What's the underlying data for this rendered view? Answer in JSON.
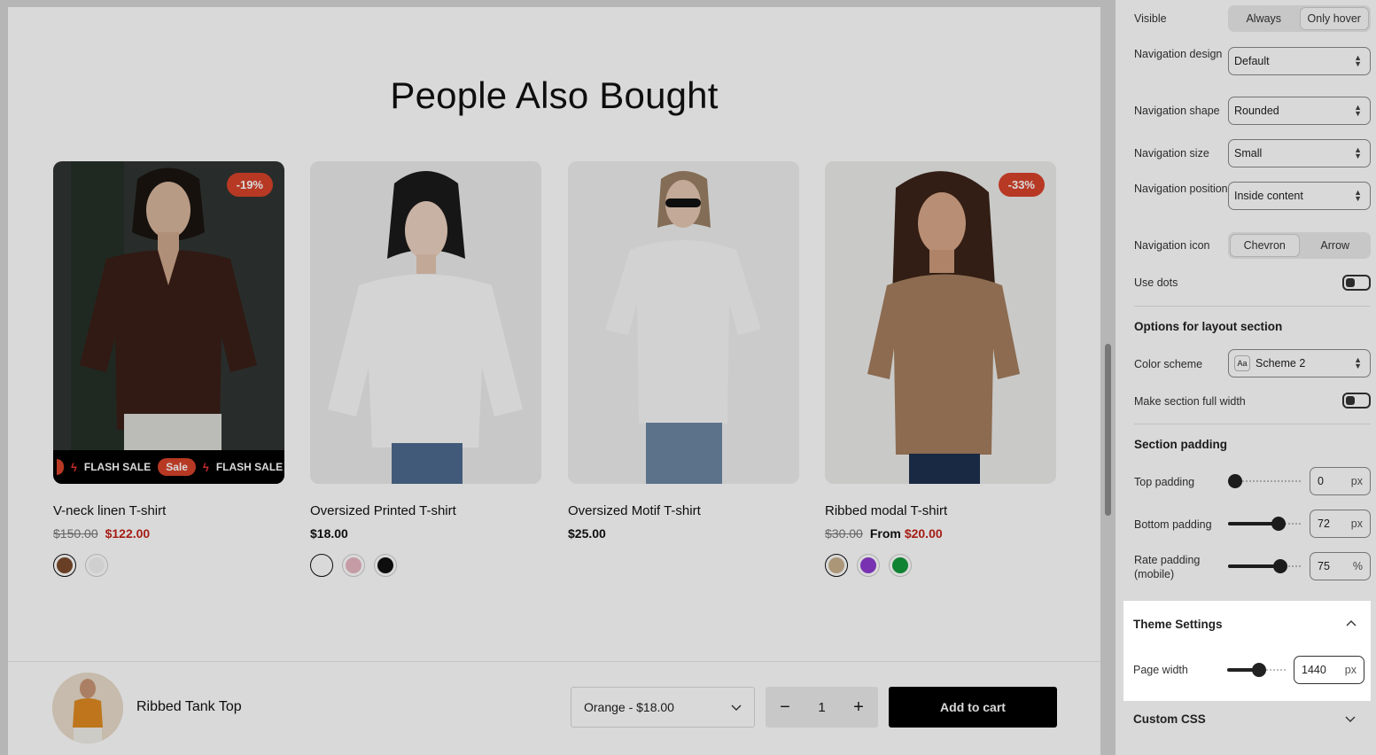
{
  "section": {
    "title": "People Also Bought"
  },
  "products": [
    {
      "name": "V-neck linen T-shirt",
      "price_old": "$150.00",
      "price": "$122.00",
      "price_prefix": "",
      "badge": "-19%",
      "flash": {
        "text1": "FLASH SALE",
        "pill": "Sale",
        "text2": "FLASH SALE"
      },
      "swatches": [
        "#7b4a2c",
        "#f4f4f4"
      ],
      "shirt_color": "#3a1f17",
      "bg": "#2f3533"
    },
    {
      "name": "Oversized Printed T-shirt",
      "price_old": "",
      "price": "$18.00",
      "price_prefix": "",
      "badge": "",
      "swatches": [
        "#ffffff",
        "#e8b8c3",
        "#111111"
      ],
      "shirt_color": "#fafafa",
      "bg": "#ebebeb"
    },
    {
      "name": "Oversized Motif T-shirt",
      "price_old": "",
      "price": "$25.00",
      "price_prefix": "",
      "badge": "",
      "swatches": [],
      "shirt_color": "#f7f7f7",
      "bg": "#efefef"
    },
    {
      "name": "Ribbed modal T-shirt",
      "price_old": "$30.00",
      "price": "$20.00",
      "price_prefix": "From",
      "badge": "-33%",
      "swatches": [
        "#c9b28e",
        "#8e3bd0",
        "#139a3b"
      ],
      "shirt_color": "#a57e5e",
      "bg": "#ededeb"
    }
  ],
  "sticky": {
    "name": "Ribbed Tank Top",
    "variant": "Orange - $18.00",
    "qty": "1",
    "minus": "−",
    "plus": "+",
    "add_to_cart": "Add to cart"
  },
  "panel": {
    "visible": {
      "label": "Visible",
      "options": [
        "Always",
        "Only hover"
      ]
    },
    "nav_design": {
      "label": "Navigation design",
      "value": "Default"
    },
    "nav_shape": {
      "label": "Navigation shape",
      "value": "Rounded"
    },
    "nav_size": {
      "label": "Navigation size",
      "value": "Small"
    },
    "nav_position": {
      "label": "Navigation position",
      "value": "Inside content"
    },
    "nav_icon": {
      "label": "Navigation icon",
      "options": [
        "Chevron",
        "Arrow"
      ]
    },
    "use_dots": {
      "label": "Use dots"
    },
    "layout_heading": "Options for layout section",
    "color_scheme": {
      "label": "Color scheme",
      "icon_text": "Aa",
      "value": "Scheme 2"
    },
    "full_width": {
      "label": "Make section full width"
    },
    "padding_heading": "Section padding",
    "top_padding": {
      "label": "Top padding",
      "value": "0",
      "unit": "px",
      "level": 0
    },
    "bottom_padding": {
      "label": "Bottom padding",
      "value": "72",
      "unit": "px",
      "level": 0.68
    },
    "rate_padding": {
      "label": "Rate padding (mobile)",
      "value": "75",
      "unit": "%",
      "level": 0.7
    },
    "theme_heading": "Theme Settings",
    "page_width": {
      "label": "Page width",
      "value": "1440",
      "unit": "px",
      "level": 0.55
    },
    "custom_css": "Custom CSS"
  },
  "icons": {
    "chevron_up": "chevron-up-icon",
    "chevron_down": "chevron-down-icon",
    "up_down": "select-arrows-icon"
  }
}
